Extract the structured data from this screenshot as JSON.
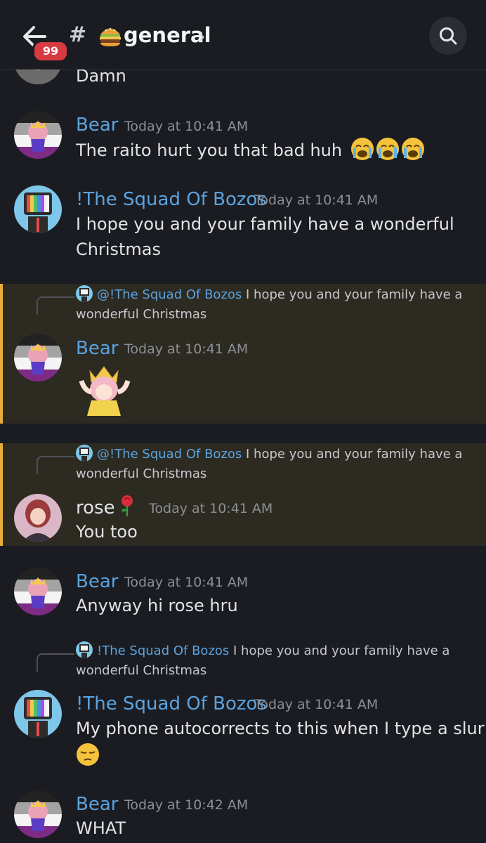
{
  "header": {
    "badge": "99",
    "hash": "#",
    "channel": "general",
    "chevron": "›"
  },
  "messages": [
    {
      "text": "Damn"
    },
    {
      "author": "Bear",
      "time": "Today at 10:41 AM",
      "text": "The raito hurt you that bad huh"
    },
    {
      "author": "!The Squad Of Bozos",
      "time": "Today at 10:41 AM",
      "line1": "I hope you and your family have a wonderful",
      "line2": "Christmas"
    },
    {
      "reply": {
        "mention": "@!The Squad Of Bozos",
        "text": "I hope you and your family have a wonderful Christmas"
      },
      "author": "Bear",
      "time": "Today at 10:41 AM"
    },
    {
      "reply": {
        "mention": "@!The Squad Of Bozos",
        "text": "I hope you and your family have a wonderful Christmas"
      },
      "author": "rose",
      "time": "Today at 10:41 AM",
      "text": "You too"
    },
    {
      "author": "Bear",
      "time": "Today at 10:41 AM",
      "text": "Anyway hi rose hru"
    },
    {
      "reply": {
        "mention": "!The Squad Of Bozos",
        "text": "I hope you and your family have a wonderful Christmas"
      },
      "author": "!The Squad Of Bozos",
      "time": "Today at 10:41 AM",
      "text": "My phone autocorrects to this when I type a slur"
    },
    {
      "author": "Bear",
      "time": "Today at 10:42 AM",
      "text": "WHAT"
    }
  ],
  "colors": {
    "link": "#5aa3e0",
    "highlight": "#2d2a22",
    "accent": "#e6ad3a",
    "badge": "#d83a42"
  },
  "icons": [
    "back-arrow-icon",
    "burger-emoji-icon",
    "chevron-right-icon",
    "search-icon",
    "crying-emoji-icon",
    "rose-emoji-icon",
    "pensive-emoji-icon"
  ]
}
